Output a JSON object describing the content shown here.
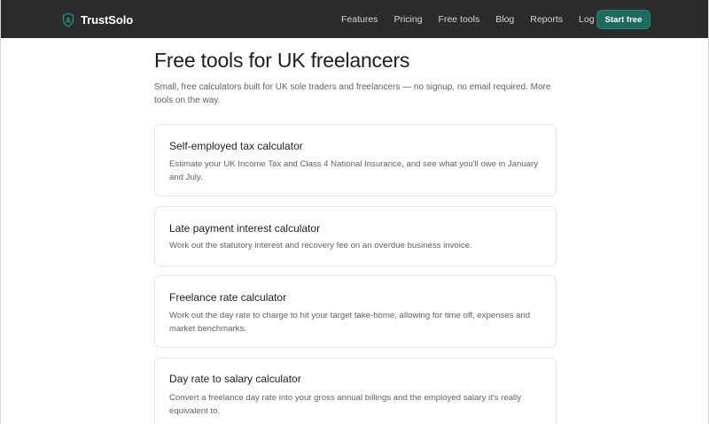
{
  "header": {
    "brand": "TrustSolo",
    "links": [
      "Features",
      "Pricing",
      "Free tools",
      "Blog",
      "Reports",
      "Log in"
    ],
    "cta": "Start free",
    "colors": {
      "background": "#2b2b2b",
      "accent": "#1d6b60"
    }
  },
  "main": {
    "title": "Free tools for UK freelancers",
    "intro": "Small, free calculators built for UK sole traders and freelancers — no signup, no email required. More tools on the way.",
    "tools": [
      {
        "title": "Self-employed tax calculator",
        "description": "Estimate your UK Income Tax and Class 4 National Insurance, and see what you'll owe in January and July."
      },
      {
        "title": "Late payment interest calculator",
        "description": "Work out the statutory interest and recovery fee on an overdue business invoice."
      },
      {
        "title": "Freelance rate calculator",
        "description": "Work out the day rate to charge to hit your target take-home, allowing for time off, expenses and market benchmarks."
      },
      {
        "title": "Day rate to salary calculator",
        "description": "Convert a freelance day rate into your gross annual billings and the employed salary it's really equivalent to."
      }
    ]
  }
}
